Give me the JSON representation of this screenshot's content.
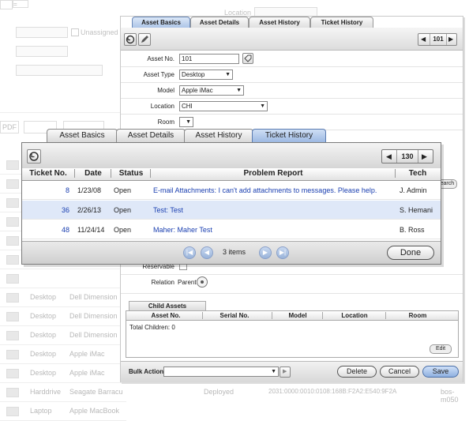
{
  "background": {
    "location_label": "Location",
    "unassigned_label": "Unassigned",
    "pdf_label": "PDF",
    "rows": [
      {
        "type": "",
        "model": ""
      },
      {
        "type": "",
        "model": ""
      },
      {
        "type": "",
        "model": ""
      },
      {
        "type": "",
        "model": ""
      },
      {
        "type": "",
        "model": ""
      },
      {
        "type": "",
        "model": ""
      },
      {
        "type": "",
        "model": ""
      },
      {
        "type": "Desktop",
        "model": "Dell Dimension"
      },
      {
        "type": "Desktop",
        "model": "Dell Dimension"
      },
      {
        "type": "Desktop",
        "model": "Dell Dimension"
      },
      {
        "type": "Desktop",
        "model": "Apple iMac"
      },
      {
        "type": "Desktop",
        "model": "Apple iMac"
      },
      {
        "type": "Harddrive",
        "model": "Seagate Barracu"
      },
      {
        "type": "Laptop",
        "model": "Apple MacBook"
      }
    ],
    "bottom_status": "Deployed",
    "bottom_mac": "2031:0000:0010:0108:168B:F2A2:E540:9F2A",
    "bottom_host": "bos-m050"
  },
  "asset_panel": {
    "tabs": [
      "Asset Basics",
      "Asset Details",
      "Asset History",
      "Ticket History"
    ],
    "active_tab": 0,
    "pager_value": "101",
    "asset_no_label": "Asset No.",
    "asset_no_value": "101",
    "asset_type_label": "Asset Type",
    "asset_type_value": "Desktop",
    "model_label": "Model",
    "model_value": "Apple iMac",
    "location_label": "Location",
    "location_value": "CHI",
    "room_label": "Room",
    "room_value": "",
    "search_button": "Search",
    "reservable_label": "Reservable",
    "relation_label": "Relation",
    "relation_value": "Parent",
    "child_assets_tab": "Child Assets",
    "child_columns": [
      "Asset No.",
      "Serial No.",
      "Model",
      "Location",
      "Room"
    ],
    "total_children": "Total Children: 0",
    "edit_button": "Edit",
    "bulk_action_label": "Bulk Action",
    "delete_button": "Delete",
    "cancel_button": "Cancel",
    "save_button": "Save"
  },
  "ticket_dialog": {
    "tabs": [
      "Asset Basics",
      "Asset Details",
      "Asset History",
      "Ticket History"
    ],
    "active_tab": 3,
    "pager_value": "130",
    "columns": [
      "Ticket No.",
      "Date",
      "Status",
      "Problem Report",
      "Tech"
    ],
    "rows": [
      {
        "ticket": "8",
        "date": "1/23/08",
        "status": "Open",
        "problem": "E-mail Attachments: I can't add attachments to messages. Please help.",
        "tech": "J. Admin"
      },
      {
        "ticket": "36",
        "date": "2/26/13",
        "status": "Open",
        "problem": "Test: Test",
        "tech": "S. Hemani"
      },
      {
        "ticket": "48",
        "date": "11/24/14",
        "status": "Open",
        "problem": "Maher: Maher Test",
        "tech": "B. Ross"
      }
    ],
    "items_count": "3 items",
    "done_button": "Done"
  },
  "colors": {
    "link_blue": "#1a3fb0",
    "highlight_row": "#dfe8f8",
    "active_tab": "#9cb8e2"
  }
}
